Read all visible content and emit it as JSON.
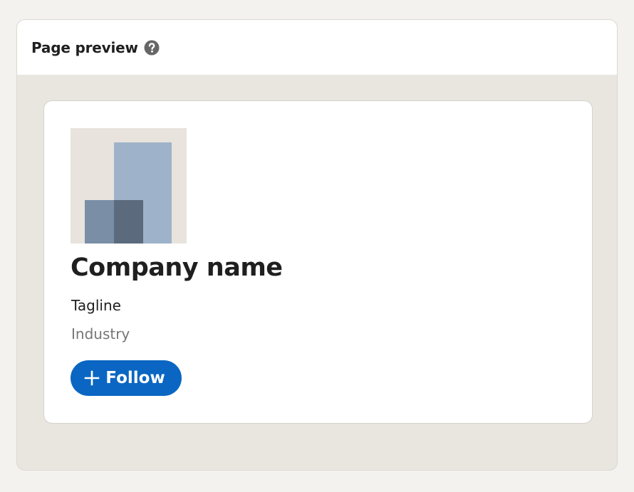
{
  "preview": {
    "title": "Page preview",
    "help_icon": "question-circle-icon"
  },
  "company": {
    "name": "Company name",
    "tagline": "Tagline",
    "industry": "Industry",
    "logo_icon": "company-placeholder-logo-icon"
  },
  "follow": {
    "label": "Follow",
    "icon": "plus-icon"
  },
  "colors": {
    "accent": "#0a66c2",
    "page_bg": "#f4f2ee",
    "panel_bg": "#e9e5df",
    "logo_bg": "#e8e3dd",
    "logo_light": "#9eb3c9",
    "logo_mid": "#7a8fa6",
    "logo_dark": "#5b6b7d"
  }
}
